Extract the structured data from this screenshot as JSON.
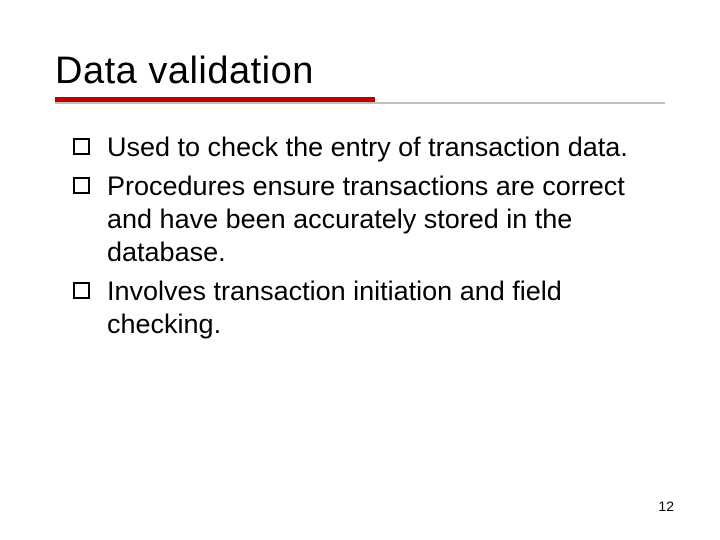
{
  "title": "Data validation",
  "bullets": [
    "Used to check the entry of transaction data.",
    "Procedures ensure transactions are correct and have been accurately stored in the database.",
    "Involves transaction initiation and field checking."
  ],
  "page_number": "12"
}
